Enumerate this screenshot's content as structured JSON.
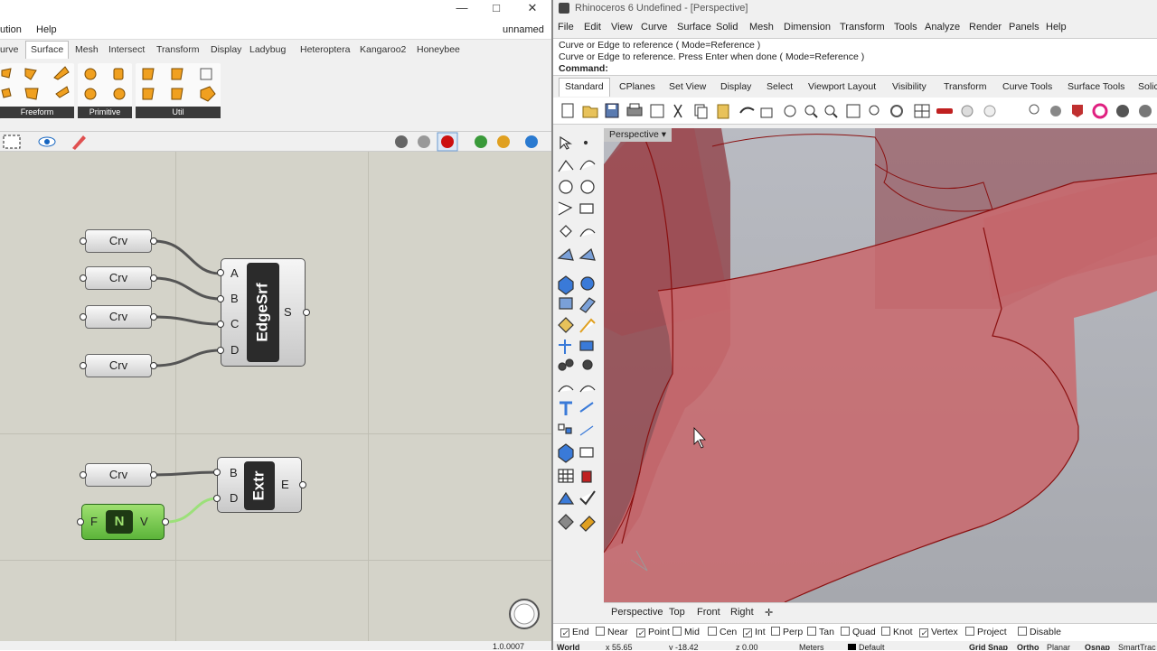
{
  "grasshopper": {
    "title": "unnamed",
    "menu": {
      "solution": "ution",
      "help": "Help"
    },
    "tabs": [
      "urve",
      "Surface",
      "Mesh",
      "Intersect",
      "Transform",
      "Display",
      "Ladybug",
      "Heteroptera",
      "Kangaroo2",
      "Honeybee"
    ],
    "ribbon_groups": [
      "Freeform",
      "Primitive",
      "Util"
    ],
    "components": {
      "edgesrf": {
        "name": "EdgeSrf",
        "inputs": [
          "A",
          "B",
          "C",
          "D"
        ],
        "output": "S"
      },
      "extr": {
        "name": "Extr",
        "inputs": [
          "B",
          "D"
        ],
        "output": "E"
      },
      "crv_label": "Crv",
      "vector": {
        "left": "F",
        "center": "N",
        "right": "V"
      }
    },
    "status_text": "1.0.0007"
  },
  "rhino": {
    "title": "Rhinoceros 6 Undefined - [Perspective]",
    "menu": [
      "File",
      "Edit",
      "View",
      "Curve",
      "Surface",
      "Solid",
      "Mesh",
      "Dimension",
      "Transform",
      "Tools",
      "Analyze",
      "Render",
      "Panels",
      "Help"
    ],
    "command_history": [
      "Curve or Edge to reference ( Mode=Reference )",
      "Curve or Edge to reference. Press Enter when done ( Mode=Reference )"
    ],
    "command_prompt": "Command:",
    "toolbar_tabs": [
      "Standard",
      "CPlanes",
      "Set View",
      "Display",
      "Select",
      "Viewport Layout",
      "Visibility",
      "Transform",
      "Curve Tools",
      "Surface Tools",
      "Solic"
    ],
    "viewport_title": "Perspective",
    "viewport_tabs": [
      "Perspective",
      "Top",
      "Front",
      "Right"
    ],
    "osnaps": [
      {
        "label": "End",
        "checked": true
      },
      {
        "label": "Near",
        "checked": false
      },
      {
        "label": "Point",
        "checked": true
      },
      {
        "label": "Mid",
        "checked": false
      },
      {
        "label": "Cen",
        "checked": false
      },
      {
        "label": "Int",
        "checked": true
      },
      {
        "label": "Perp",
        "checked": false
      },
      {
        "label": "Tan",
        "checked": false
      },
      {
        "label": "Quad",
        "checked": false
      },
      {
        "label": "Knot",
        "checked": false
      },
      {
        "label": "Vertex",
        "checked": true
      },
      {
        "label": "Project",
        "checked": false
      },
      {
        "label": "Disable",
        "checked": false
      }
    ],
    "statusbar": {
      "cplane": "World",
      "x": "x 55.65",
      "y": "y -18.42",
      "z": "z 0.00",
      "units": "Meters",
      "layer": "Default",
      "grid_snap": "Grid Snap",
      "ortho": "Ortho",
      "planar": "Planar",
      "osnap": "Osnap",
      "smarttrack": "SmartTrac"
    }
  },
  "colors": {
    "surface": "#c86a6e",
    "edge": "#8a1010",
    "canvas": "#d4d3c9",
    "gh_green": "#6cc04a"
  }
}
